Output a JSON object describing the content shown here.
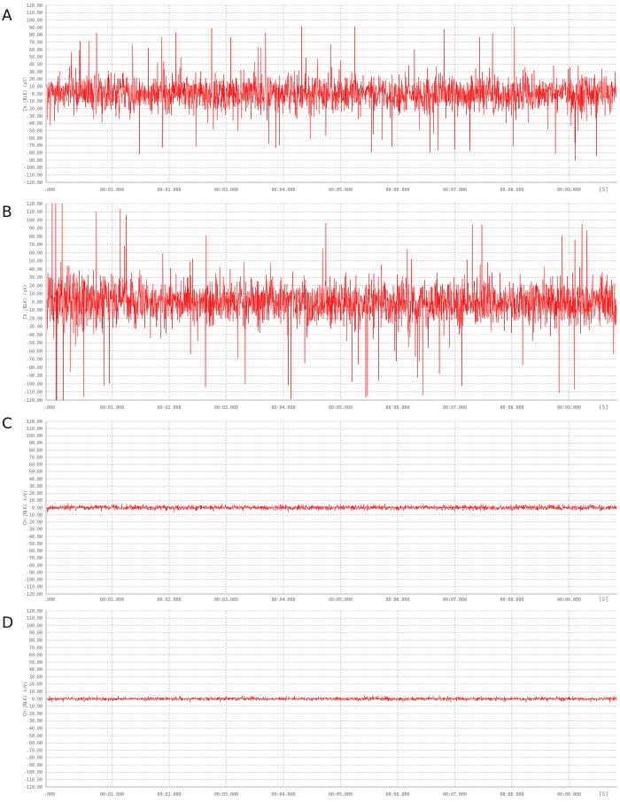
{
  "chart_data": [
    {
      "type": "line",
      "panel_label": "A",
      "ylabel": "Ch.(BLK) (uV)",
      "ylim": [
        -120,
        120
      ],
      "yticks": [
        "120.00",
        "110.00",
        "100.00",
        "90.00",
        "80.00",
        "70.00",
        "60.00",
        "50.00",
        "40.00",
        "30.00",
        "20.00",
        "10.00",
        "0.00",
        "-10.00",
        "-20.00",
        "-30.00",
        "-40.00",
        "-50.00",
        "-60.00",
        "-70.00",
        "-80.00",
        "-90.00",
        "-100.00",
        "-110.00",
        "-120.00"
      ],
      "xticks": [
        ".000",
        "00:01.000",
        "00:02.000",
        "00:03.000",
        "00:04.000",
        "00:05.000",
        "00:06.000",
        "00:07.000",
        "00:08.000",
        "00:09.000"
      ],
      "x_unit": "[S]",
      "series": [
        {
          "amplitude_core": 22,
          "amplitude_peak": 95,
          "color": "#ff0000"
        }
      ]
    },
    {
      "type": "line",
      "panel_label": "B",
      "ylabel": "Ch.(BLK) (uV)",
      "ylim": [
        -120,
        120
      ],
      "yticks": [
        "120.00",
        "110.00",
        "100.00",
        "90.00",
        "80.00",
        "70.00",
        "60.00",
        "50.00",
        "40.00",
        "30.00",
        "20.00",
        "10.00",
        "0.00",
        "-10.00",
        "-20.00",
        "-30.00",
        "-40.00",
        "-50.00",
        "-60.00",
        "-70.00",
        "-80.00",
        "-90.00",
        "-100.00",
        "-110.00",
        "-120.00"
      ],
      "xticks": [
        ".000",
        "00:01.000",
        "00:02.000",
        "00:03.000",
        "00:04.000",
        "00:05.000",
        "00:06.000",
        "00:07.000",
        "00:08.000",
        "00:09.000"
      ],
      "x_unit": "[S]",
      "series": [
        {
          "amplitude_core": 25,
          "amplitude_peak": 120,
          "color": "#ff0000"
        }
      ]
    },
    {
      "type": "line",
      "panel_label": "C",
      "ylabel": "Ch.(BLK) (uV)",
      "ylim": [
        -120,
        120
      ],
      "yticks": [
        "120.00",
        "110.00",
        "100.00",
        "90.00",
        "80.00",
        "70.00",
        "60.00",
        "50.00",
        "40.00",
        "30.00",
        "20.00",
        "10.00",
        "0.00",
        "-10.00",
        "-20.00",
        "-30.00",
        "-40.00",
        "-50.00",
        "-60.00",
        "-70.00",
        "-80.00",
        "-90.00",
        "-100.00",
        "-110.00",
        "-120.00"
      ],
      "xticks": [
        ".000",
        "00:01.000",
        "00:02.000",
        "00:03.000",
        "00:04.000",
        "00:05.000",
        "00:06.000",
        "00:07.000",
        "00:08.000",
        "00:09.000"
      ],
      "x_unit": "[S]",
      "series": [
        {
          "amplitude_core": 3,
          "amplitude_peak": 5,
          "color": "#ff0000"
        }
      ]
    },
    {
      "type": "line",
      "panel_label": "D",
      "ylabel": "Ch.(BLK) (uV)",
      "ylim": [
        -120,
        120
      ],
      "yticks": [
        "120.00",
        "110.00",
        "100.00",
        "90.00",
        "80.00",
        "70.00",
        "60.00",
        "50.00",
        "40.00",
        "30.00",
        "20.00",
        "10.00",
        "0.00",
        "-10.00",
        "-20.00",
        "-30.00",
        "-40.00",
        "-50.00",
        "-60.00",
        "-70.00",
        "-80.00",
        "-90.00",
        "-100.00",
        "-110.00",
        "-120.00"
      ],
      "xticks": [
        ".000",
        "00:01.000",
        "00:02.000",
        "00:03.000",
        "00:04.000",
        "00:05.000",
        "00:06.000",
        "00:07.000",
        "00:08.000",
        "00:09.000"
      ],
      "x_unit": "[S]",
      "series": [
        {
          "amplitude_core": 2,
          "amplitude_peak": 5,
          "color": "#ff0000"
        }
      ]
    }
  ]
}
